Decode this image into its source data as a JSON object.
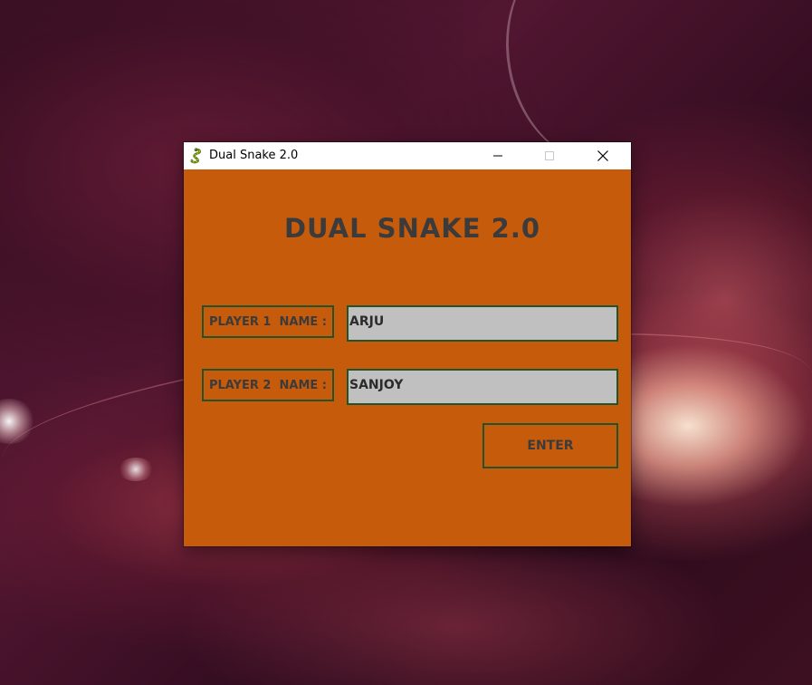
{
  "window": {
    "title": "Dual Snake 2.0"
  },
  "game": {
    "title": "DUAL SNAKE 2.0"
  },
  "form": {
    "player1_label": "PLAYER 1  NAME :",
    "player1_value": "ARJU",
    "player2_label": "PLAYER 2  NAME :",
    "player2_value": "SANJOY",
    "enter_label": "ENTER"
  },
  "icons": {
    "app": "snake-icon",
    "minimize": "minimize-icon",
    "maximize": "maximize-icon",
    "close": "close-icon"
  },
  "colors": {
    "window_background": "#c75b0c",
    "border": "#23532b",
    "input_background": "#c0c0c0",
    "text": "#3b3b3b"
  }
}
